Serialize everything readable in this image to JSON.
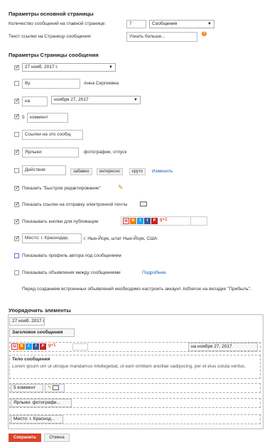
{
  "main_params": {
    "title": "Параметры основной страницы",
    "posts_count_label": "Количество сообщений на главной странице:",
    "posts_count_value": "7",
    "posts_unit": "Сообщения",
    "read_more_label": "Текст ссылки на Страницу сообщения:",
    "read_more_value": "Узнать больше..."
  },
  "post_params": {
    "title": "Параметры Страницы сообщения",
    "date_value": "27 нояб. 2017 г.",
    "by_label": "By",
    "author_name": "Анна Сергеевна",
    "on_label": "на",
    "date2_value": "ноября 27, 2017",
    "comments_count": "5",
    "comments_label": "коммент",
    "links_label": "Ссылки на это сообщ",
    "labels_label": "Ярлыки:",
    "labels_value": "фотографии, отпуск",
    "actions_label": "Действия:",
    "reactions": [
      "забавно",
      "интересно",
      "круто"
    ],
    "change_link": "Изменить",
    "quick_edit": "Показать \"Быстрое редактирование\"",
    "email_link": "Показать ссылки на отправку электронной почты",
    "share_buttons": "Показывать кнопки для публикации",
    "location_label": "Место: г. Краснодар,",
    "location_value": "г. Нью-Йорк, штат Нью-Йорк, США",
    "author_profile": "Показывать профиль автора под сообщением",
    "ads_label": "Показывать объявления между сообщениями",
    "ads_more_link": "Подробнее",
    "adsense_note": "Перед созданием встроенных объявлений необходимо настроить аккаунт AdSense на вкладке \"Прибыль\"."
  },
  "arrange": {
    "title": "Упорядочить элементы",
    "date": "27 нояб. 2017 г.",
    "post_title": "Заголовок сообщения",
    "share_date": "на ноября 27, 2017",
    "body_title": "Тело сообщения",
    "body_text": "Lorem ipsum um ut utroque mandamus intellegebat, ut eam omittam ancillae sadipscing, per et eius soluta veritus.",
    "comments": "5 коммент",
    "labels": "Ярлыки: фотографи...",
    "location": "Место: г. Краснод..."
  },
  "buttons": {
    "save": "Сохранить",
    "cancel": "Отмена"
  },
  "colors": {
    "accent_link": "#1a5fb4",
    "save_button": "#d9442b",
    "help_icon": "#f08a24"
  }
}
